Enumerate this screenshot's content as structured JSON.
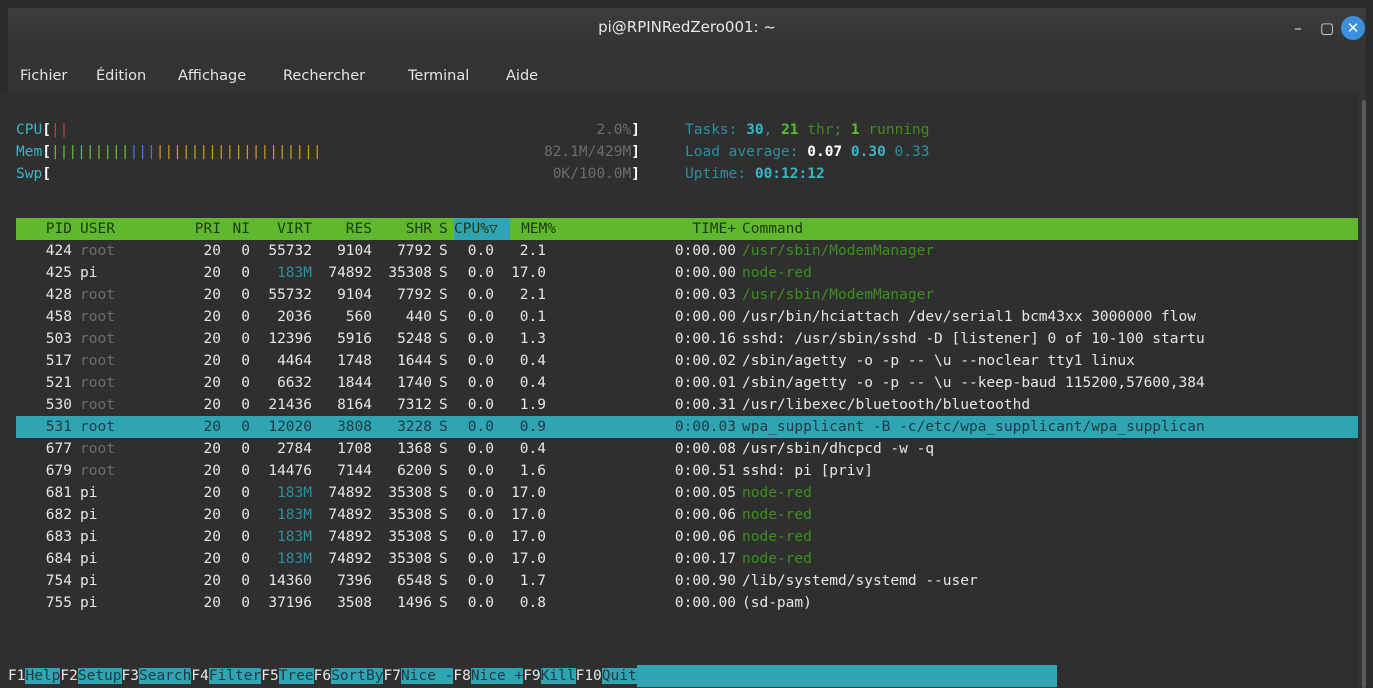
{
  "window": {
    "title": "pi@RPINRedZero001: ~",
    "min": "–",
    "max": "▢",
    "close": "✕"
  },
  "menu": [
    "Fichier",
    "Édition",
    "Affichage",
    "Rechercher",
    "Terminal",
    "Aide"
  ],
  "meters": {
    "cpu": {
      "label": "CPU",
      "bar": "||",
      "value": "2.0%"
    },
    "mem": {
      "label": "Mem",
      "bar_green": "|||||||||",
      "bar_blue": "|||",
      "bar_orange": "|||||||||||||||||||",
      "value": "82.1M/429M"
    },
    "swp": {
      "label": "Swp",
      "value": "0K/100.0M"
    }
  },
  "summary": {
    "tasks_label": "Tasks:",
    "tasks": "30",
    "thr": "21",
    "thr_label": "thr;",
    "running": "1",
    "running_label": "running",
    "load_label": "Load average:",
    "load1": "0.07",
    "load5": "0.30",
    "load15": "0.33",
    "uptime_label": "Uptime:",
    "uptime": "00:12:12"
  },
  "columns": [
    "PID",
    "USER",
    "PRI",
    "NI",
    "VIRT",
    "RES",
    "SHR",
    "S",
    "CPU%▽",
    "MEM%",
    "TIME+",
    "Command"
  ],
  "processes": [
    {
      "pid": "424",
      "user": "root",
      "pri": "20",
      "ni": "0",
      "virt": "55732",
      "res": "9104",
      "shr": "7792",
      "s": "S",
      "cpu": "0.0",
      "mem": "2.1",
      "time": "0:00.00",
      "cmd": "/usr/sbin/ModemManager",
      "kind": "thread"
    },
    {
      "pid": "425",
      "user": "pi",
      "pri": "20",
      "ni": "0",
      "virt": "183M",
      "res": "74892",
      "shr": "35308",
      "s": "S",
      "cpu": "0.0",
      "mem": "17.0",
      "time": "0:00.00",
      "cmd": "node-red",
      "kind": "thread"
    },
    {
      "pid": "428",
      "user": "root",
      "pri": "20",
      "ni": "0",
      "virt": "55732",
      "res": "9104",
      "shr": "7792",
      "s": "S",
      "cpu": "0.0",
      "mem": "2.1",
      "time": "0:00.03",
      "cmd": "/usr/sbin/ModemManager",
      "kind": "thread"
    },
    {
      "pid": "458",
      "user": "root",
      "pri": "20",
      "ni": "0",
      "virt": "2036",
      "res": "560",
      "shr": "440",
      "s": "S",
      "cpu": "0.0",
      "mem": "0.1",
      "time": "0:00.00",
      "cmd": "/usr/bin/hciattach /dev/serial1 bcm43xx 3000000 flow",
      "kind": "proc"
    },
    {
      "pid": "503",
      "user": "root",
      "pri": "20",
      "ni": "0",
      "virt": "12396",
      "res": "5916",
      "shr": "5248",
      "s": "S",
      "cpu": "0.0",
      "mem": "1.3",
      "time": "0:00.16",
      "cmd": "sshd: /usr/sbin/sshd -D [listener] 0 of 10-100 startu",
      "kind": "proc"
    },
    {
      "pid": "517",
      "user": "root",
      "pri": "20",
      "ni": "0",
      "virt": "4464",
      "res": "1748",
      "shr": "1644",
      "s": "S",
      "cpu": "0.0",
      "mem": "0.4",
      "time": "0:00.02",
      "cmd": "/sbin/agetty -o -p -- \\u --noclear tty1 linux",
      "kind": "proc"
    },
    {
      "pid": "521",
      "user": "root",
      "pri": "20",
      "ni": "0",
      "virt": "6632",
      "res": "1844",
      "shr": "1740",
      "s": "S",
      "cpu": "0.0",
      "mem": "0.4",
      "time": "0:00.01",
      "cmd": "/sbin/agetty -o -p -- \\u --keep-baud 115200,57600,384",
      "kind": "proc"
    },
    {
      "pid": "530",
      "user": "root",
      "pri": "20",
      "ni": "0",
      "virt": "21436",
      "res": "8164",
      "shr": "7312",
      "s": "S",
      "cpu": "0.0",
      "mem": "1.9",
      "time": "0:00.31",
      "cmd": "/usr/libexec/bluetooth/bluetoothd",
      "kind": "proc"
    },
    {
      "pid": "531",
      "user": "root",
      "pri": "20",
      "ni": "0",
      "virt": "12020",
      "res": "3808",
      "shr": "3228",
      "s": "S",
      "cpu": "0.0",
      "mem": "0.9",
      "time": "0:00.03",
      "cmd": "wpa_supplicant -B -c/etc/wpa_supplicant/wpa_supplican",
      "kind": "selected"
    },
    {
      "pid": "677",
      "user": "root",
      "pri": "20",
      "ni": "0",
      "virt": "2784",
      "res": "1708",
      "shr": "1368",
      "s": "S",
      "cpu": "0.0",
      "mem": "0.4",
      "time": "0:00.08",
      "cmd": "/usr/sbin/dhcpcd -w -q",
      "kind": "proc"
    },
    {
      "pid": "679",
      "user": "root",
      "pri": "20",
      "ni": "0",
      "virt": "14476",
      "res": "7144",
      "shr": "6200",
      "s": "S",
      "cpu": "0.0",
      "mem": "1.6",
      "time": "0:00.51",
      "cmd": "sshd: pi [priv]",
      "kind": "proc"
    },
    {
      "pid": "681",
      "user": "pi",
      "pri": "20",
      "ni": "0",
      "virt": "183M",
      "res": "74892",
      "shr": "35308",
      "s": "S",
      "cpu": "0.0",
      "mem": "17.0",
      "time": "0:00.05",
      "cmd": "node-red",
      "kind": "thread"
    },
    {
      "pid": "682",
      "user": "pi",
      "pri": "20",
      "ni": "0",
      "virt": "183M",
      "res": "74892",
      "shr": "35308",
      "s": "S",
      "cpu": "0.0",
      "mem": "17.0",
      "time": "0:00.06",
      "cmd": "node-red",
      "kind": "thread"
    },
    {
      "pid": "683",
      "user": "pi",
      "pri": "20",
      "ni": "0",
      "virt": "183M",
      "res": "74892",
      "shr": "35308",
      "s": "S",
      "cpu": "0.0",
      "mem": "17.0",
      "time": "0:00.06",
      "cmd": "node-red",
      "kind": "thread"
    },
    {
      "pid": "684",
      "user": "pi",
      "pri": "20",
      "ni": "0",
      "virt": "183M",
      "res": "74892",
      "shr": "35308",
      "s": "S",
      "cpu": "0.0",
      "mem": "17.0",
      "time": "0:00.17",
      "cmd": "node-red",
      "kind": "thread"
    },
    {
      "pid": "754",
      "user": "pi",
      "pri": "20",
      "ni": "0",
      "virt": "14360",
      "res": "7396",
      "shr": "6548",
      "s": "S",
      "cpu": "0.0",
      "mem": "1.7",
      "time": "0:00.90",
      "cmd": "/lib/systemd/systemd --user",
      "kind": "proc"
    },
    {
      "pid": "755",
      "user": "pi",
      "pri": "20",
      "ni": "0",
      "virt": "37196",
      "res": "3508",
      "shr": "1496",
      "s": "S",
      "cpu": "0.0",
      "mem": "0.8",
      "time": "0:00.00",
      "cmd": "(sd-pam)",
      "kind": "proc"
    }
  ],
  "fkeys": [
    {
      "key": "F1",
      "label": "Help  "
    },
    {
      "key": "F2",
      "label": "Setup "
    },
    {
      "key": "F3",
      "label": "Search"
    },
    {
      "key": "F4",
      "label": "Filter"
    },
    {
      "key": "F5",
      "label": "Tree  "
    },
    {
      "key": "F6",
      "label": "SortBy"
    },
    {
      "key": "F7",
      "label": "Nice -"
    },
    {
      "key": "F8",
      "label": "Nice +"
    },
    {
      "key": "F9",
      "label": "Kill  "
    },
    {
      "key": "F10",
      "label": "Quit  "
    }
  ]
}
